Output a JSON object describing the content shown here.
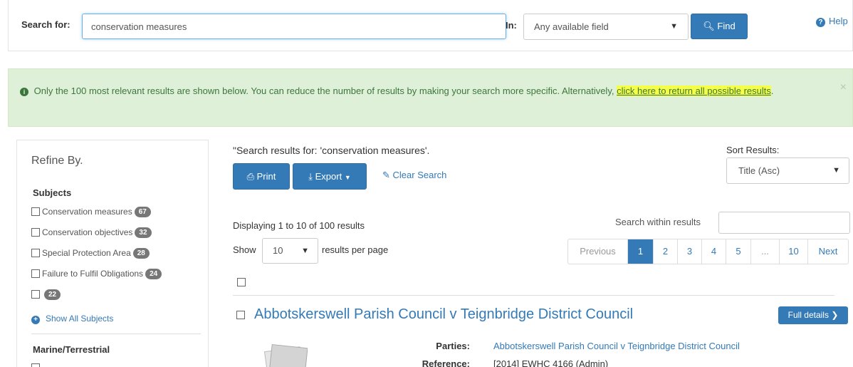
{
  "search": {
    "label": "Search for:",
    "query": "conservation measures",
    "in_label": "In:",
    "field": "Any available field",
    "find_label": "Find",
    "help_label": "Help"
  },
  "alert": {
    "text": "Only the 100 most relevant results are shown below. You can reduce the number of results by making your search more specific. Alternatively, ",
    "link": "click here to return all possible results",
    "suffix": "."
  },
  "sidebar": {
    "title": "Refine By.",
    "subjects_title": "Subjects",
    "subjects": [
      {
        "label": "Conservation measures",
        "count": "67"
      },
      {
        "label": "Conservation objectives",
        "count": "32"
      },
      {
        "label": "Special Protection Area",
        "count": "28"
      },
      {
        "label": "Failure to Fulfil Obligations",
        "count": "24"
      },
      {
        "label": "",
        "count": "22"
      }
    ],
    "show_all": "Show All Subjects",
    "marine_title": "Marine/Terrestrial"
  },
  "main": {
    "heading": "\"Search results for: 'conservation measures'.",
    "print_label": "Print",
    "export_label": "Export",
    "clear_label": "Clear Search",
    "sort_label": "Sort Results:",
    "sort_value": "Title (Asc)",
    "display_count": "Displaying 1 to 10 of 100 results",
    "within_label": "Search within results",
    "show_label": "Show",
    "per_page": "10",
    "per_page_label": "results per page",
    "pagination": [
      "Previous",
      "1",
      "2",
      "3",
      "4",
      "5",
      "...",
      "10",
      "Next"
    ],
    "active_page": "1"
  },
  "result": {
    "title": "Abbotskerswell Parish Council v Teignbridge District Council",
    "full_details": "Full details",
    "parties_label": "Parties:",
    "parties_value": "Abbotskerswell Parish Council v Teignbridge District Council",
    "reference_label": "Reference:",
    "reference_value": "[2014] EWHC 4166 (Admin)"
  },
  "colors": {
    "primary": "#337ab7",
    "alert_bg": "#dff0d8",
    "highlight": "#f5ff48"
  }
}
